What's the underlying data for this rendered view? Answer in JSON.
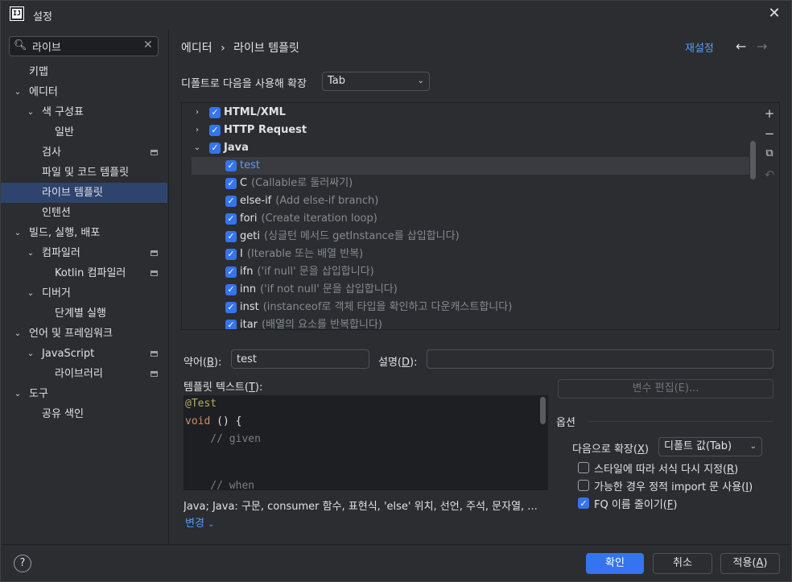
{
  "window": {
    "title": "설정",
    "logo_text": "IJ"
  },
  "search": {
    "value": "라이브"
  },
  "sidebar": {
    "items": [
      {
        "label": "키맵",
        "depth": 0,
        "expand": "",
        "selected": false,
        "module": false
      },
      {
        "label": "에디터",
        "depth": 0,
        "expand": "open",
        "selected": false,
        "module": false
      },
      {
        "label": "색 구성표",
        "depth": 1,
        "expand": "open",
        "selected": false,
        "module": false
      },
      {
        "label": "일반",
        "depth": 2,
        "expand": "",
        "selected": false,
        "module": false
      },
      {
        "label": "검사",
        "depth": 1,
        "expand": "",
        "selected": false,
        "module": true
      },
      {
        "label": "파일 및 코드 템플릿",
        "depth": 1,
        "expand": "",
        "selected": false,
        "module": false
      },
      {
        "label": "라이브 템플릿",
        "depth": 1,
        "expand": "",
        "selected": true,
        "module": false
      },
      {
        "label": "인텐션",
        "depth": 1,
        "expand": "",
        "selected": false,
        "module": false
      },
      {
        "label": "빌드, 실행, 배포",
        "depth": 0,
        "expand": "open",
        "selected": false,
        "module": false
      },
      {
        "label": "컴파일러",
        "depth": 1,
        "expand": "open",
        "selected": false,
        "module": true
      },
      {
        "label": "Kotlin 컴파일러",
        "depth": 2,
        "expand": "",
        "selected": false,
        "module": true
      },
      {
        "label": "디버거",
        "depth": 1,
        "expand": "open",
        "selected": false,
        "module": false
      },
      {
        "label": "단계별 실행",
        "depth": 2,
        "expand": "",
        "selected": false,
        "module": false
      },
      {
        "label": "언어 및 프레임워크",
        "depth": 0,
        "expand": "open",
        "selected": false,
        "module": false
      },
      {
        "label": "JavaScript",
        "depth": 1,
        "expand": "open",
        "selected": false,
        "module": true
      },
      {
        "label": "라이브러리",
        "depth": 2,
        "expand": "",
        "selected": false,
        "module": true
      },
      {
        "label": "도구",
        "depth": 0,
        "expand": "open",
        "selected": false,
        "module": false
      },
      {
        "label": "공유 색인",
        "depth": 1,
        "expand": "",
        "selected": false,
        "module": false
      }
    ]
  },
  "header": {
    "crumb_parent": "에디터",
    "crumb_sep": "›",
    "crumb_current": "라이브 템플릿",
    "reset": "재설정"
  },
  "expand_with": {
    "label": "디폴트로 다음을 사용해 확장",
    "value": "Tab"
  },
  "templates": [
    {
      "abbr": "HTML/XML",
      "desc": "",
      "group": true,
      "expand": "closed",
      "selected": false
    },
    {
      "abbr": "HTTP Request",
      "desc": "",
      "group": true,
      "expand": "closed",
      "selected": false
    },
    {
      "abbr": "Java",
      "desc": "",
      "group": true,
      "expand": "open",
      "selected": false
    },
    {
      "abbr": "test",
      "desc": "",
      "group": false,
      "expand": "",
      "selected": true
    },
    {
      "abbr": "C",
      "desc": "(Callable로 둘러싸기)",
      "group": false,
      "expand": "",
      "selected": false
    },
    {
      "abbr": "else-if",
      "desc": "(Add else-if branch)",
      "group": false,
      "expand": "",
      "selected": false
    },
    {
      "abbr": "fori",
      "desc": "(Create iteration loop)",
      "group": false,
      "expand": "",
      "selected": false
    },
    {
      "abbr": "geti",
      "desc": "(싱글턴 메서드 getInstance를 삽입합니다)",
      "group": false,
      "expand": "",
      "selected": false
    },
    {
      "abbr": "I",
      "desc": "(Iterable 또는 배열 반복)",
      "group": false,
      "expand": "",
      "selected": false
    },
    {
      "abbr": "ifn",
      "desc": "('if null' 문을 삽입합니다)",
      "group": false,
      "expand": "",
      "selected": false
    },
    {
      "abbr": "inn",
      "desc": "('if not null' 문을 삽입합니다)",
      "group": false,
      "expand": "",
      "selected": false
    },
    {
      "abbr": "inst",
      "desc": "(instanceof로 객체 타입을 확인하고 다운캐스트합니다)",
      "group": false,
      "expand": "",
      "selected": false
    },
    {
      "abbr": "itar",
      "desc": "(배열의 요소를 반복합니다)",
      "group": false,
      "expand": "",
      "selected": false
    }
  ],
  "tools": {
    "add": "+",
    "remove": "−",
    "copy": "⧉",
    "restore": "↶"
  },
  "fields": {
    "abbr_label": "약어(",
    "abbr_key": "B",
    "abbr_tail": "):",
    "abbr_value": "test",
    "desc_label": "설명(",
    "desc_key": "D",
    "desc_tail": "):",
    "desc_value": "",
    "text_label": "템플릿 텍스트(",
    "text_key": "T",
    "text_tail": "):",
    "vars_button": "변수 편집(E)..."
  },
  "editor": {
    "line1": "@Test",
    "line2_kw": "void",
    "line2_rest": " () {",
    "line3": "    // given",
    "line4": "",
    "line5": "",
    "line6": "    // when"
  },
  "options": {
    "title": "옵션",
    "expand_label": "다음으로 확장(",
    "expand_key": "X",
    "expand_tail": ")",
    "expand_value": "디폴트 값(Tab)",
    "reformat": {
      "text": "스타일에 따라 서식 다시 지정(",
      "key": "R",
      "tail": ")",
      "checked": false
    },
    "static_import": {
      "text": "가능한 경우 정적 import 문 사용(",
      "key": "I",
      "tail": ")",
      "checked": false
    },
    "shorten_fq": {
      "text": "FQ 이름 줄이기(",
      "key": "F",
      "tail": ")",
      "checked": true
    }
  },
  "context": {
    "text": "Java; Java: 구문, consumer 함수, 표현식, 'else' 위치, 선언, 주석, 문자열, ...",
    "change": "변경"
  },
  "footer": {
    "help": "?",
    "ok": "확인",
    "cancel": "취소",
    "apply": "적용(",
    "apply_key": "A",
    "apply_tail": ")"
  },
  "colors": {
    "accent": "#3574f0",
    "link": "#589df6",
    "selection": "#2e436e",
    "background": "#2b2d30"
  }
}
